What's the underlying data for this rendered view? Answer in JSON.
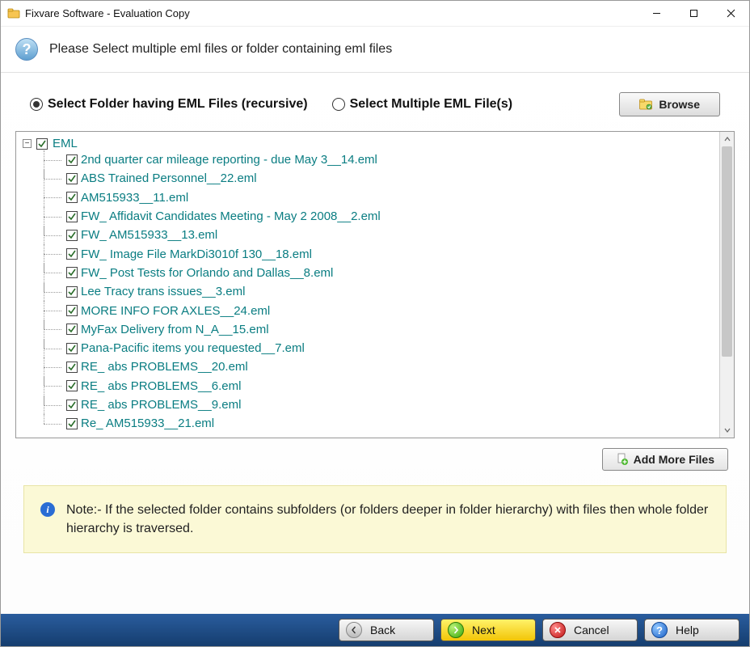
{
  "window": {
    "title": "Fixvare Software - Evaluation Copy"
  },
  "header": {
    "instruction": "Please Select multiple eml files or folder containing eml files"
  },
  "options": {
    "folder_label": "Select Folder having EML Files (recursive)",
    "multi_label": "Select Multiple EML File(s)",
    "selected": "folder"
  },
  "browse_label": "Browse",
  "tree": {
    "root_label": "EML",
    "files": [
      "2nd quarter car mileage reporting - due May 3__14.eml",
      "ABS Trained Personnel__22.eml",
      "AM515933__11.eml",
      "FW_ Affidavit Candidates Meeting - May 2 2008__2.eml",
      "FW_ AM515933__13.eml",
      "FW_ Image File MarkDi3010f 130__18.eml",
      "FW_ Post Tests for Orlando and Dallas__8.eml",
      "Lee Tracy trans issues__3.eml",
      "MORE INFO FOR AXLES__24.eml",
      "MyFax Delivery from N_A__15.eml",
      "Pana-Pacific items you requested__7.eml",
      "RE_ abs PROBLEMS__20.eml",
      "RE_ abs PROBLEMS__6.eml",
      "RE_ abs PROBLEMS__9.eml",
      "Re_ AM515933__21.eml"
    ]
  },
  "add_more_label": "Add More Files",
  "note": {
    "text": "Note:- If the selected folder contains subfolders (or folders deeper in folder hierarchy) with files then whole folder hierarchy is traversed."
  },
  "footer": {
    "back": "Back",
    "next": "Next",
    "cancel": "Cancel",
    "help": "Help"
  }
}
